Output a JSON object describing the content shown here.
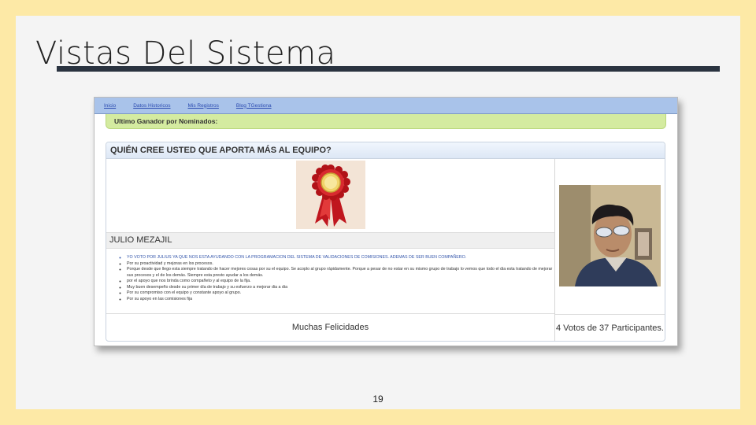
{
  "slide": {
    "title": "Vistas Del Sistema",
    "page_number": "19"
  },
  "nav": {
    "items": [
      {
        "label": "Inicio"
      },
      {
        "label": "Datos Historicos"
      },
      {
        "label": "Mis Registros"
      },
      {
        "label": "Blog TGestiona"
      }
    ]
  },
  "winner_banner": "Ultimo Ganador por Nominados:",
  "panel": {
    "question": "QUIÉN CREE USTED QUE APORTA MÁS AL EQUIPO?",
    "winner_name": "JULIO MEZAJIL",
    "comments": [
      "YO VOTO POR JULIUS YA QUE NOS ESTA AYUDANDO CON LA PROGRAMACION DEL SISTEMA DE VALIDACIONES DE COMISIONES. ADEMAS DE SER BUEN COMPAÑERO.",
      "Por su proactividad y mejoras en los procesos.",
      "Porque desde que llego esta siempre tratando de hacer mejores cosas por su el equipo. Se acoplo al grupo rápidamente. Porque a pesar de no estar en su mismo grupo de trabajo lo vemos que todo el dia esta tratando de mejorar sus procesos y el de los demás. Siempre esta presto ayudar a los demás.",
      "por el apoyo que nos brinda como compañeto y al equipo de la fija.",
      "Muy buen desempeño desde su primer día de trabajo y su esfuerzo a mejorar dia a dia",
      "Por su compromiso con el equipo y constante apoyo al grupo.",
      "Por su apoyo en las comisiones fija"
    ],
    "congrats": "Muchas Felicidades",
    "votes": "4 Votos de 37 Participantes."
  },
  "colors": {
    "slide_border": "#fde9a6",
    "nav_bg": "#a9c3ea",
    "banner_bg": "#d4eba0",
    "title_rule": "#2a3340"
  },
  "icons": {
    "award": "red-rosette-award-icon",
    "photo": "winner-profile-photo"
  }
}
